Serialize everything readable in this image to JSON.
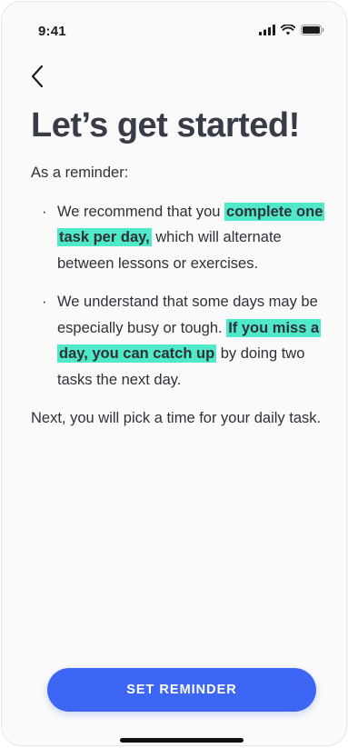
{
  "status_bar": {
    "time": "9:41",
    "icons": [
      "cellular-signal-icon",
      "wifi-icon",
      "battery-icon"
    ]
  },
  "nav": {
    "back_icon": "chevron-left-icon"
  },
  "screen": {
    "title": "Let’s get started!",
    "intro": "As a reminder:",
    "bullets": [
      {
        "text_before": "We recommend that you ",
        "highlight": "complete one task per day,",
        "text_after": " which will alternate between lessons or exercises."
      },
      {
        "text_before": "We understand that some days may be especially busy or tough. ",
        "highlight": "If you miss a day, you can catch up",
        "text_after": " by doing two tasks the next day."
      }
    ],
    "outro": "Next, you will pick a time for your daily task."
  },
  "cta": {
    "label": "SET REMINDER"
  },
  "colors": {
    "highlight": "#4fe8c9",
    "primary_button": "#3d66f5",
    "title_text": "#383b48",
    "body_text": "#2f3138"
  }
}
